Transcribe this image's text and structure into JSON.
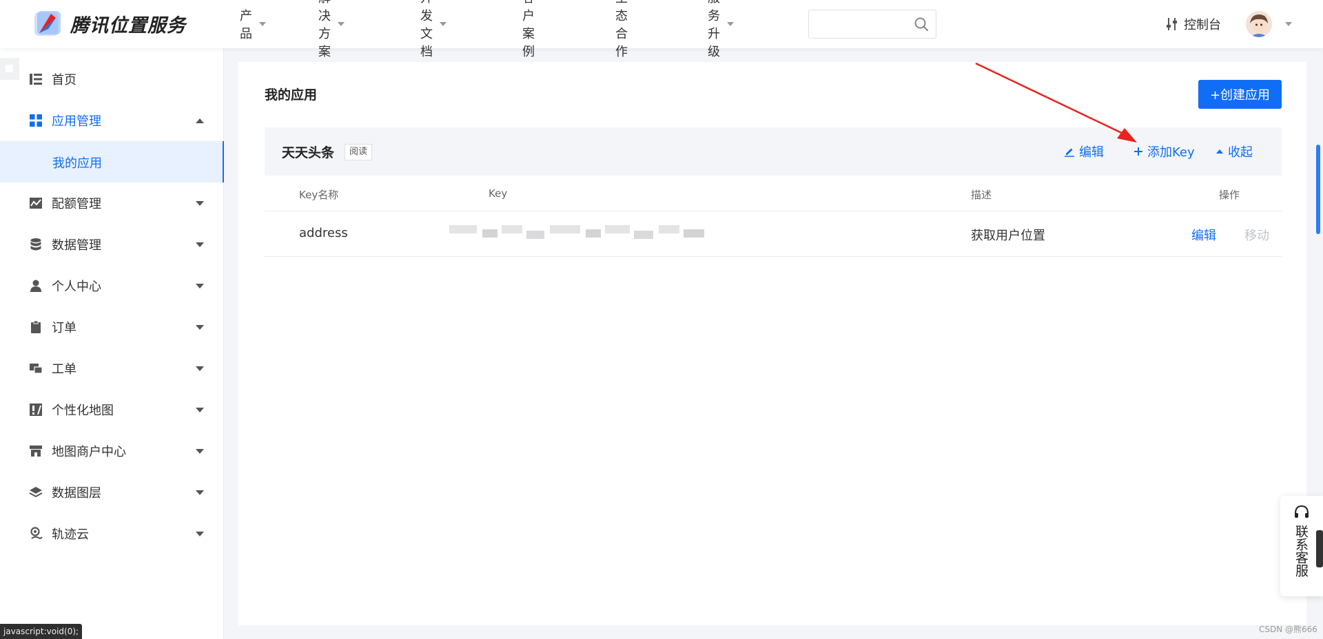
{
  "header": {
    "logo_text": "腾讯位置服务",
    "nav": [
      {
        "label": "产品",
        "has_caret": true
      },
      {
        "label": "解决方案",
        "has_caret": true
      },
      {
        "label": "开发文档",
        "has_caret": true
      },
      {
        "label": "客户案例",
        "has_caret": false
      },
      {
        "label": "生态合作",
        "has_caret": false
      },
      {
        "label": "服务升级",
        "has_caret": true
      }
    ],
    "search_placeholder": "",
    "console_label": "控制台"
  },
  "sidebar": {
    "items": [
      {
        "label": "首页",
        "icon": "home-list-icon"
      },
      {
        "label": "应用管理",
        "icon": "grid-icon",
        "expanded": true
      },
      {
        "label": "配额管理",
        "icon": "chart-area-icon"
      },
      {
        "label": "数据管理",
        "icon": "database-icon"
      },
      {
        "label": "个人中心",
        "icon": "user-icon"
      },
      {
        "label": "订单",
        "icon": "clipboard-icon"
      },
      {
        "label": "工单",
        "icon": "ticket-icon"
      },
      {
        "label": "个性化地图",
        "icon": "map-style-icon"
      },
      {
        "label": "地图商户中心",
        "icon": "store-icon"
      },
      {
        "label": "数据图层",
        "icon": "layers-icon"
      },
      {
        "label": "轨迹云",
        "icon": "track-icon"
      }
    ],
    "sub_item": "我的应用"
  },
  "main": {
    "title": "我的应用",
    "create_button": "+创建应用",
    "app": {
      "name": "天天头条",
      "badge": "阅读",
      "edit_label": "编辑",
      "add_key_label": "添加Key",
      "collapse_label": "收起"
    },
    "table": {
      "columns": [
        "Key名称",
        "Key",
        "描述",
        "操作"
      ],
      "rows": [
        {
          "name": "address",
          "key": "",
          "desc": "获取用户位置",
          "edit": "编辑",
          "move": "移动"
        }
      ]
    }
  },
  "contact": {
    "label": "联系客服"
  },
  "status_bar": {
    "link": "javascript:void(0);"
  },
  "watermark": "CSDN @熊666",
  "colors": {
    "accent": "#0f6ef5",
    "annotation": "#e8221c"
  }
}
